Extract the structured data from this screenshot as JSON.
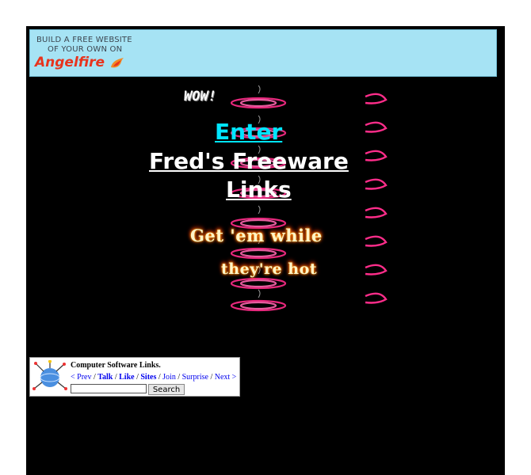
{
  "banner": {
    "line1": "BUILD A FREE WEBSITE",
    "line2": "OF YOUR OWN ON",
    "brand": "Angelfire"
  },
  "splash": {
    "wow": "WOW!",
    "enter_label": "Enter",
    "site_title_line1": "Fred's Freeware",
    "site_title_line2": "Links",
    "tagline_line1": "Get 'em while",
    "tagline_line2": "they're hot"
  },
  "webring": {
    "title": "Computer Software Links.",
    "links": [
      "< Prev",
      "Talk",
      "Like",
      "Sites",
      "Join",
      "Surprise",
      "Next >"
    ],
    "search_value": "",
    "search_button": "Search"
  },
  "colors": {
    "page_bg": "#000000",
    "banner_bg": "#a6e3f4",
    "enter_link": "#00e5ff",
    "title_link": "#ffffff",
    "brand": "#e8331d"
  }
}
